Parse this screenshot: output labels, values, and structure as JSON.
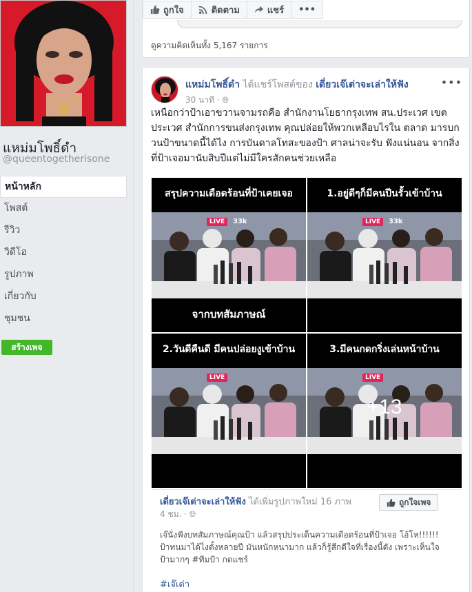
{
  "sidebar": {
    "page_name": "แหม่มโพธิ์ดำ",
    "handle": "@queentogetherisone",
    "nav": [
      {
        "label": "หน้าหลัก",
        "active": true
      },
      {
        "label": "โพสต์"
      },
      {
        "label": "รีวิว"
      },
      {
        "label": "วิดีโอ"
      },
      {
        "label": "รูปภาพ"
      },
      {
        "label": "เกี่ยวกับ"
      },
      {
        "label": "ชุมชน"
      }
    ],
    "create_page": "สร้างเพจ"
  },
  "top_post": {
    "like": "ถูกใจ",
    "follow": "ติดตาม",
    "share": "แชร์",
    "more": "•••",
    "view_comments": "ดูความคิดเห็นทั้ง 5,167 รายการ"
  },
  "post": {
    "author": "แหม่มโพธิ์ดำ",
    "verb": "ได้แชร์โพสต์ของ",
    "source": "เดี่ยวเจ๊เต่าจะเล่าให้ฟัง",
    "time": "30 นาที ·",
    "more": "•••",
    "text": "เหนือกว่าป้าเอาขวานจามรถคือ สำนักงานโยธากรุงเทพ สน.ประเวศ เขตประเวศ สำนักการขนส่งกรุงเทพ คุณปล่อยให้พวกเหลือบไรใน ตลาด มารบกวนป้าขนาดนี้ได้ไง การบันดาลโทสะของป้า ศาลน่าจะรับ ฟังแน่นอน จากสิ่งที่ป้าเจอมานับสิบปีแต่ไม่มีใครสักคนช่วยเหลือ",
    "tiles": [
      {
        "title": "สรุปความเดือดร้อนที่ป้าเคยเจอ",
        "caption": "จากบทสัมภาษณ์",
        "live": "LIVE",
        "views": "33k"
      },
      {
        "title": "1.อยู่ดีๆก็มีคนปีนรั้วเข้าบ้าน",
        "caption": "",
        "live": "LIVE",
        "views": "33k"
      },
      {
        "title": "2.วันดีคืนดี มีคนปล่อยงูเข้าบ้าน",
        "caption": "",
        "live": "LIVE",
        "views": ""
      },
      {
        "title": "3.มีคนกดกริ่งเล่นหน้าบ้าน",
        "caption": "",
        "live": "LIVE",
        "views": "",
        "overlay": "+13"
      }
    ],
    "shared": {
      "source": "เดี่ยวเจ๊เต่าจะเล่าให้ฟัง",
      "verb": "ได้เพิ่มรูปภาพใหม่ 16 ภาพ",
      "time": "4 ชม. ·",
      "like_page": "ถูกใจเพจ",
      "text": "เจ๊นั่งฟังบทสัมภาษณ์คุณป้า แล้วสรุปประเด็นความเดือดร้อนที่ป้าเจอ โอ้โห!!!!!! ป้าทนมาได้ไงตั้งหลายปี มันหนักหนามาก แล้วก็รู้สึกดีใจที่เรื่องนี้ดัง เพราะเห็นใจป้ามากๆ #ทีมป้า กดแชร์",
      "hashtag": "#เจ๊เต่า"
    }
  },
  "colors": {
    "link": "#365899",
    "green": "#42b72a",
    "live": "#e0245e",
    "bg": "#e9ebee"
  }
}
